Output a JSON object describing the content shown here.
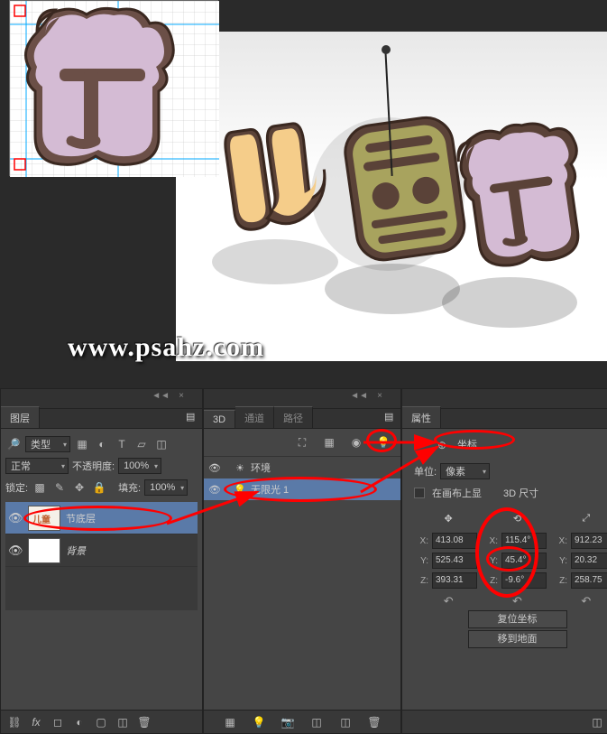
{
  "watermark": "www.psahz.com",
  "layers_panel": {
    "tab_label": "图层",
    "filter_label": "类型",
    "blend_mode": "正常",
    "opacity_label": "不透明度:",
    "opacity_value": "100%",
    "lock_label": "锁定:",
    "fill_label": "填充:",
    "fill_value": "100%",
    "layers": [
      {
        "name": "节底层",
        "visible": true,
        "highlighted": true
      },
      {
        "name": "背景",
        "visible": true,
        "highlighted": false
      }
    ]
  },
  "three_d_panel": {
    "tabs": [
      "3D",
      "通道",
      "路径"
    ],
    "active_tab": "3D",
    "items": [
      {
        "name": "环境",
        "icon": "sun"
      },
      {
        "name": "无限光 1",
        "icon": "bulb",
        "highlighted": true
      }
    ]
  },
  "properties_panel": {
    "tab_label": "属性",
    "coord_tab": "坐标",
    "unit_label": "单位:",
    "unit_value": "像素",
    "canvas_label": "在画布上显",
    "size_label": "3D 尺寸",
    "position": {
      "x": "413.08",
      "y": "525.43",
      "z": "393.31"
    },
    "rotation": {
      "x": "115.4°",
      "y": "45.4°",
      "z": "-9.6°"
    },
    "scale": {
      "x": "912.23",
      "y": "20.32",
      "z": "258.75"
    },
    "reset_btn": "复位坐标",
    "ground_btn": "移到地面"
  }
}
